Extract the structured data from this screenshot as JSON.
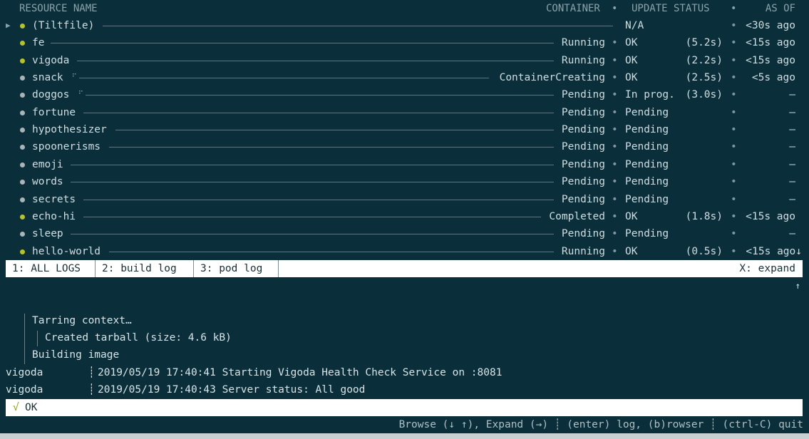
{
  "colors": {
    "background": "#0b2f3a",
    "ok_dot": "#b6c22b",
    "pending_dot": "#a9b4b8",
    "tab_bg": "#ffffff",
    "check": "#8da11b"
  },
  "header": {
    "resource_name": "RESOURCE NAME",
    "container": "CONTAINER",
    "update_status": "UPDATE STATUS",
    "as_of": "AS OF",
    "sep": "•"
  },
  "resources": [
    {
      "name": "(Tiltfile)",
      "container": "",
      "update": "N/A",
      "time": "",
      "as_of": "<30s ago",
      "status": "ok",
      "arrow": "▶",
      "spinner": ""
    },
    {
      "name": "fe",
      "container": "Running",
      "update": "OK",
      "time": "(5.2s)",
      "as_of": "<15s ago",
      "status": "ok",
      "arrow": "",
      "spinner": ""
    },
    {
      "name": "vigoda",
      "container": "Running",
      "update": "OK",
      "time": "(2.2s)",
      "as_of": "<15s ago",
      "status": "ok",
      "arrow": "",
      "spinner": ""
    },
    {
      "name": "snack",
      "container": "ContainerCreating",
      "update": "OK",
      "time": "(2.5s)",
      "as_of": "<5s ago",
      "status": "pending",
      "arrow": "",
      "spinner": "⠋"
    },
    {
      "name": "doggos",
      "container": "Pending",
      "update": "In prog.",
      "time": "(3.0s)",
      "as_of": "–",
      "status": "pending",
      "arrow": "",
      "spinner": "⠋"
    },
    {
      "name": "fortune",
      "container": "Pending",
      "update": "Pending",
      "time": "",
      "as_of": "–",
      "status": "pending",
      "arrow": "",
      "spinner": ""
    },
    {
      "name": "hypothesizer",
      "container": "Pending",
      "update": "Pending",
      "time": "",
      "as_of": "–",
      "status": "pending",
      "arrow": "",
      "spinner": ""
    },
    {
      "name": "spoonerisms",
      "container": "Pending",
      "update": "Pending",
      "time": "",
      "as_of": "–",
      "status": "pending",
      "arrow": "",
      "spinner": ""
    },
    {
      "name": "emoji",
      "container": "Pending",
      "update": "Pending",
      "time": "",
      "as_of": "–",
      "status": "pending",
      "arrow": "",
      "spinner": ""
    },
    {
      "name": "words",
      "container": "Pending",
      "update": "Pending",
      "time": "",
      "as_of": "–",
      "status": "pending",
      "arrow": "",
      "spinner": ""
    },
    {
      "name": "secrets",
      "container": "Pending",
      "update": "Pending",
      "time": "",
      "as_of": "–",
      "status": "pending",
      "arrow": "",
      "spinner": ""
    },
    {
      "name": "echo-hi",
      "container": "Completed",
      "update": "OK",
      "time": "(1.8s)",
      "as_of": "<15s ago",
      "status": "ok",
      "arrow": "",
      "spinner": ""
    },
    {
      "name": "sleep",
      "container": "Pending",
      "update": "Pending",
      "time": "",
      "as_of": "–",
      "status": "pending",
      "arrow": "",
      "spinner": ""
    },
    {
      "name": "hello-world",
      "container": "Running",
      "update": "OK",
      "time": "(0.5s)",
      "as_of": "<15s ago↓",
      "status": "ok",
      "arrow": "",
      "spinner": ""
    }
  ],
  "tabs": [
    {
      "label": "1: ALL LOGS"
    },
    {
      "label": "2: build log"
    },
    {
      "label": "3: pod log"
    }
  ],
  "expand_label": "X: expand",
  "scroll_up": "↑",
  "log": {
    "tarring": "Tarring context…",
    "tarball": "Created tarball (size: 4.6 kB)",
    "building": "Building image",
    "lines": [
      {
        "source": "vigoda",
        "text": "2019/05/19 17:40:41 Starting Vigoda Health Check Service on :8081"
      },
      {
        "source": "vigoda",
        "text": "2019/05/19 17:40:43 Server status: All good"
      }
    ]
  },
  "ok_bar": {
    "check": "√",
    "text": "OK"
  },
  "footer": "Browse (↓ ↑), Expand (→) ┊ (enter) log, (b)rowser ┊ (ctrl-C) quit"
}
